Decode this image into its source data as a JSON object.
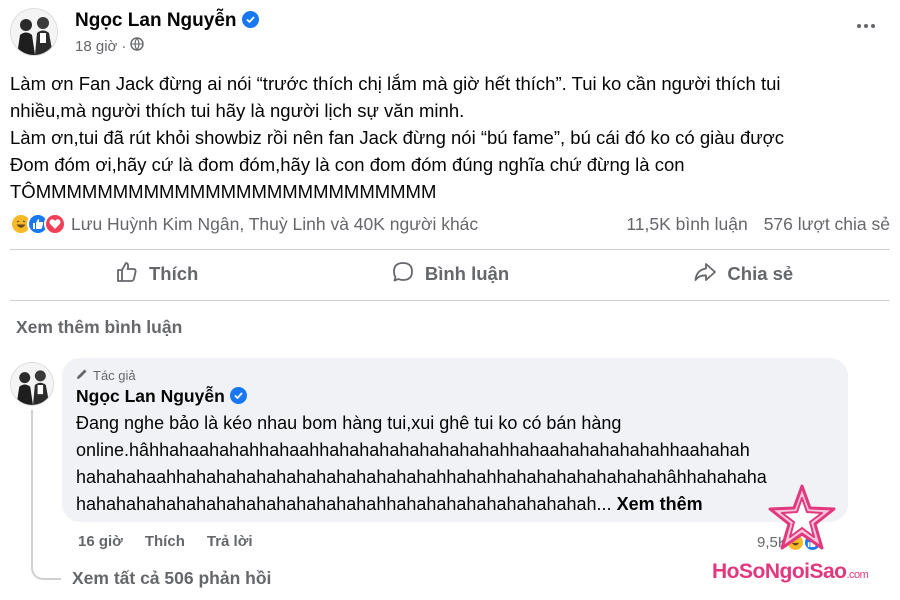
{
  "post": {
    "author": "Ngọc Lan Nguyễn",
    "time": "18 giờ",
    "lines": [
      "Làm ơn Fan Jack đừng ai nói “trước thích chị lắm mà giờ hết thích”. Tui ko cần người thích tui",
      "nhiều,mà người thích tui hãy là người lịch sự văn minh.",
      "Làm ơn,tui đã rút khỏi showbiz rồi nên fan Jack đừng nói “bú fame”, bú cái đó ko có giàu được",
      "Đom đóm ơi,hãy cứ là đom đóm,hãy là con đom đóm đúng nghĩa chứ đừng là con",
      "TÔMMMMMMMMMMMMMMMMMMMMMMMMMM"
    ]
  },
  "stats": {
    "reactors": "Lưu Huỳnh Kim Ngân, Thuỳ Linh và 40K người khác",
    "comments": "11,5K bình luận",
    "shares": "576 lượt chia sẻ"
  },
  "actions": {
    "like": "Thích",
    "comment": "Bình luận",
    "share": "Chia sẻ"
  },
  "more_comments": "Xem thêm bình luận",
  "comment": {
    "badge": "Tác giả",
    "author": "Ngọc Lan Nguyễn",
    "lines": [
      "Đang nghe bảo là kéo nhau bom hàng tui,xui ghê tui ko có bán hàng",
      "online.hâhhahaahahahhahaahhahahahahahahahahahhahaahahahahahahhaahahah",
      "hahahahaahhahahahahahahahahahahahahahhahahhahahahahahahahahâhhahahaha",
      "hahahahahahahahahahahahahahahahhahahahahahahahahahah..."
    ],
    "see_more": "Xem thêm",
    "time": "16 giờ",
    "like": "Thích",
    "reply": "Trả lời",
    "reaction_count": "9,5K"
  },
  "view_replies": "Xem tất cả 506 phản hồi",
  "watermark": {
    "brand": "HoSoNgoiSao",
    "suffix": ".com",
    "color": "#e2387d"
  },
  "colors": {
    "verified": "#1877f2",
    "secondary_text": "#65676b",
    "bubble_bg": "#f0f2f5"
  },
  "icons": [
    "verified-badge-icon",
    "globe-icon",
    "more-options-icon",
    "haha-reaction-icon",
    "like-reaction-icon",
    "love-reaction-icon",
    "thumbs-up-icon",
    "comment-bubble-icon",
    "share-arrow-icon",
    "pencil-icon",
    "star-logo-icon"
  ]
}
